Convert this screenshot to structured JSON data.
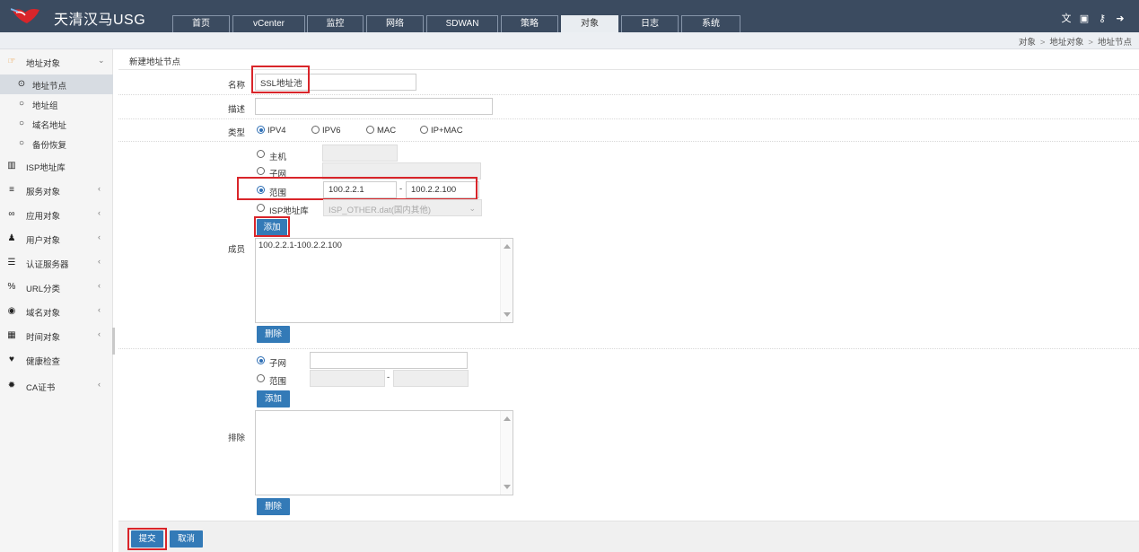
{
  "header": {
    "brand": "天清汉马USG",
    "tabs": [
      "首页",
      "vCenter",
      "监控",
      "网络",
      "SDWAN",
      "策略",
      "对象",
      "日志",
      "系统"
    ],
    "active_tab": "对象"
  },
  "breadcrumb": [
    "对象",
    "地址对象",
    "地址节点"
  ],
  "breadcrumb_sep": ">",
  "sidebar": {
    "items": [
      {
        "label": "地址对象",
        "icon": "hand-pointer-icon"
      },
      {
        "label": "地址节点",
        "icon": "radio-dot-icon"
      },
      {
        "label": "地址组",
        "icon": "circle-icon"
      },
      {
        "label": "域名地址",
        "icon": "circle-icon"
      },
      {
        "label": "备份恢复",
        "icon": "circle-icon"
      },
      {
        "label": "ISP地址库",
        "icon": "map-icon"
      },
      {
        "label": "服务对象",
        "icon": "list-icon"
      },
      {
        "label": "应用对象",
        "icon": "link-icon"
      },
      {
        "label": "用户对象",
        "icon": "users-icon"
      },
      {
        "label": "认证服务器",
        "icon": "server-icon"
      },
      {
        "label": "URL分类",
        "icon": "url-icon"
      },
      {
        "label": "域名对象",
        "icon": "globe-icon"
      },
      {
        "label": "时间对象",
        "icon": "calendar-icon"
      },
      {
        "label": "健康检查",
        "icon": "heartbeat-icon"
      },
      {
        "label": "CA证书",
        "icon": "certificate-icon"
      }
    ],
    "expand_open": "⌄",
    "expand_closed": "‹"
  },
  "form": {
    "title": "新建地址节点",
    "name_label": "名称",
    "name_value": "SSL地址池",
    "desc_label": "描述",
    "desc_value": "",
    "type_label": "类型",
    "type_options": [
      "IPV4",
      "IPV6",
      "MAC",
      "IP+MAC"
    ],
    "type_selected": "IPV4",
    "member_label": "成员",
    "member_modes": [
      "主机",
      "子网",
      "范围",
      "ISP地址库"
    ],
    "member_mode_selected": "范围",
    "range_start": "100.2.2.1",
    "range_end": "100.2.2.100",
    "range_dash": "-",
    "isp_select_value": "ISP_OTHER.dat(国内其他)",
    "add_label": "添加",
    "members": [
      "100.2.2.1-100.2.2.100"
    ],
    "delete_label": "删除",
    "exclude_label": "排除",
    "exclude_modes": [
      "子网",
      "范围"
    ],
    "exclude_mode_selected": "子网",
    "exclude_dash": "-",
    "submit_label": "提交",
    "cancel_label": "取消"
  },
  "colors": {
    "header_bg": "#3b4b60",
    "button_blue": "#337ab7",
    "highlight_red": "#d9252a"
  }
}
